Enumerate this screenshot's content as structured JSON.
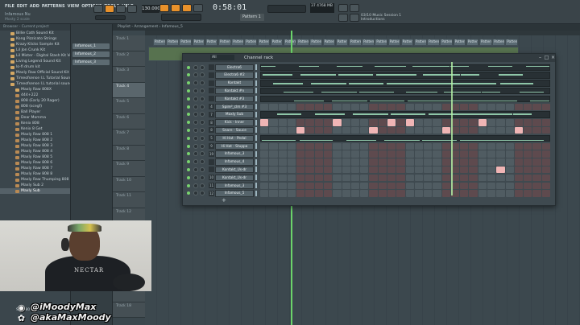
{
  "toolbar": {
    "menu": [
      "FILE",
      "EDIT",
      "ADD",
      "PATTERNS",
      "VIEW",
      "OPTIONS",
      "TOOLS",
      "HELP"
    ],
    "song_title": "Infamous Nu",
    "song_sub": "Mosty 2 scale",
    "tempo": "130.000",
    "time": "0:58:01",
    "pattern": "Pattern 1",
    "cpu": "37  4768 MB",
    "hint_line1": "03/10  Music Session 1",
    "hint_line2": "Introductions"
  },
  "browser": {
    "header": "Browser - Current project",
    "items": [
      {
        "label": "Billie Cath Sound Kit",
        "type": "folder"
      },
      {
        "label": "Kong Pizzicato Strings",
        "type": "folder"
      },
      {
        "label": "Krazy Klicks Sample Kit",
        "type": "folder"
      },
      {
        "label": "Lil Jon Crunk Kit",
        "type": "folder"
      },
      {
        "label": "Lil Mister - Digital Stash Kit Vol. 1",
        "type": "folder"
      },
      {
        "label": "Living Legend Sound Kit",
        "type": "folder"
      },
      {
        "label": "lo-fi drum kit",
        "type": "folder"
      },
      {
        "label": "Maxly Raw Official Sound Kit",
        "type": "folder"
      },
      {
        "label": "Timeofsense I.L Tutorial Sounds",
        "type": "folder"
      },
      {
        "label": "Timeofsense I.L tutorial sounds",
        "type": "folder"
      },
      {
        "label": "Maxly Raw 808X",
        "type": "folder",
        "level": 2
      },
      {
        "label": "444+222",
        "type": "file",
        "level": 2
      },
      {
        "label": "808 (Early 20 Rager)",
        "type": "file",
        "level": 2
      },
      {
        "label": "808 (scegf)",
        "type": "file",
        "level": 2
      },
      {
        "label": "Ball Player",
        "type": "file",
        "level": 2
      },
      {
        "label": "Dear Momma",
        "type": "file",
        "level": 2
      },
      {
        "label": "Kenix 808",
        "type": "file",
        "level": 2
      },
      {
        "label": "Kenix 8 Get",
        "type": "file",
        "level": 2
      },
      {
        "label": "Maxly Raw 808 1",
        "type": "file",
        "level": 2
      },
      {
        "label": "Maxly Raw 808 2",
        "type": "file",
        "level": 2
      },
      {
        "label": "Maxly Raw 808 3",
        "type": "file",
        "level": 2
      },
      {
        "label": "Maxly Raw 808 4",
        "type": "file",
        "level": 2
      },
      {
        "label": "Maxly Raw 808 5",
        "type": "file",
        "level": 2
      },
      {
        "label": "Maxly Raw 808 6",
        "type": "file",
        "level": 2
      },
      {
        "label": "Maxly Raw 808 7",
        "type": "file",
        "level": 2
      },
      {
        "label": "Maxly Raw 808 8",
        "type": "file",
        "level": 2
      },
      {
        "label": "Maxly Raw Thumping 808",
        "type": "file",
        "level": 2
      },
      {
        "label": "Maxly Sub 2",
        "type": "file",
        "level": 2
      },
      {
        "label": "Maxly Sub",
        "type": "file",
        "level": 2,
        "selected": true
      }
    ],
    "bottom_item": "Stas 808"
  },
  "picker": {
    "items": [
      "Infamous_1",
      "Infamous_2",
      "Infamous_3"
    ]
  },
  "playlist": {
    "title": "Playlist - Arrangement › Infamous_5",
    "tracks": [
      "Track 1",
      "Track 2",
      "Track 3",
      "Track 4",
      "Track 5",
      "Track 6",
      "Track 7",
      "Track 8",
      "Track 9",
      "Track 10",
      "Track 11",
      "Track 12",
      "Track 13",
      "Track 14",
      "Track 15",
      "Track 16",
      "Track 17",
      "Track 18"
    ],
    "active_track": "Track 4",
    "clip_label": "Pattern 1"
  },
  "rack": {
    "title": "Channel rack",
    "filter": "All",
    "channels": [
      {
        "num": "",
        "name": "Electra6",
        "mode": "roll"
      },
      {
        "num": "",
        "name": "Electra6 #2",
        "mode": "roll"
      },
      {
        "num": "",
        "name": "Kontakt",
        "mode": "roll"
      },
      {
        "num": "",
        "name": "Kontakt #n",
        "mode": "roll"
      },
      {
        "num": "",
        "name": "Kontakt #3",
        "mode": "roll"
      },
      {
        "num": "4",
        "name": "Spire²_clm #3",
        "mode": "steps"
      },
      {
        "num": "7",
        "name": "Maxly Sub",
        "mode": "roll"
      },
      {
        "num": "8",
        "name": "Kick - Inner",
        "mode": "steps"
      },
      {
        "num": "8",
        "name": "Snare - Sauce",
        "mode": "steps"
      },
      {
        "num": "5",
        "name": "Hi Hat - Pedal",
        "mode": "roll"
      },
      {
        "num": "9",
        "name": "Hi Hat - Stuppa",
        "mode": "steps"
      },
      {
        "num": "19",
        "name": "Infamous_3",
        "mode": "steps"
      },
      {
        "num": "",
        "name": "Infamous_4",
        "mode": "steps"
      },
      {
        "num": "",
        "name": "Kontakt_Us-dr",
        "mode": "steps"
      },
      {
        "num": "10",
        "name": "Kontakt_Us-dr",
        "mode": "steps"
      },
      {
        "num": "11",
        "name": "Infamous_3",
        "mode": "steps"
      },
      {
        "num": "12",
        "name": "Infamous_5",
        "mode": "steps"
      }
    ]
  },
  "overlay": {
    "shirt_text": "NECTAR",
    "instagram_handle": "@iMoodyMax",
    "twitter_handle": "@akaMaxMoody"
  },
  "colors": {
    "accent": "#e8912b",
    "playhead": "#6bd46a",
    "step_on": "#f0b5b5"
  }
}
